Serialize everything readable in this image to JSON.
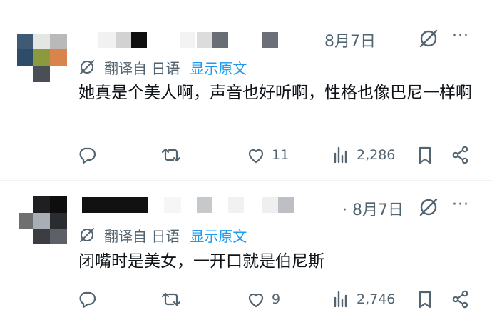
{
  "posts": [
    {
      "date": "8月7日",
      "show_dot": false,
      "translate_label": "翻译自 日语",
      "show_original": "显示原文",
      "text": "她真是个美人啊，声音也好听啊，性格也像巴尼一样啊",
      "likes": "11",
      "views": "2,286"
    },
    {
      "date": "· 8月7日",
      "show_dot": true,
      "translate_label": "翻译自 日语",
      "show_original": "显示原文",
      "text": "闭嘴时是美女，一开口就是伯尼斯",
      "likes": "9",
      "views": "2,746"
    }
  ],
  "colors": {
    "text": "#0f1419",
    "muted": "#536471",
    "link": "#1d9bf0",
    "divider": "#eff3f4"
  },
  "icons": [
    "grok-icon",
    "more-icon",
    "translate-icon",
    "reply-icon",
    "retweet-icon",
    "like-icon",
    "views-icon",
    "bookmark-icon",
    "share-icon"
  ]
}
